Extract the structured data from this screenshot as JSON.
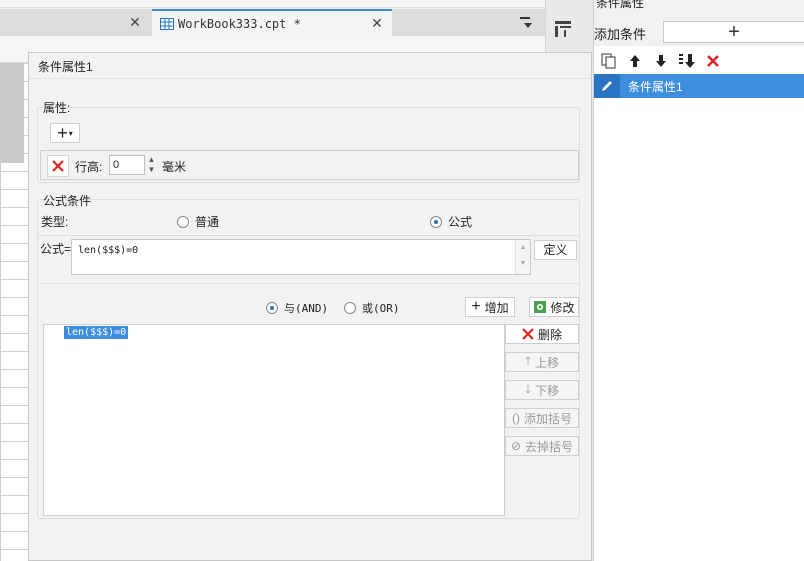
{
  "editor": {
    "tabs": [
      {
        "title": ""
      },
      {
        "title": "WorkBook333.cpt *"
      }
    ]
  },
  "right_panel": {
    "title": "条件属性",
    "add_condition_label": "添加条件",
    "add_condition_button": "+",
    "tools": [
      "copy-icon",
      "arrow-up-icon",
      "arrow-down-icon",
      "sort-down-icon",
      "delete-icon"
    ],
    "conditions": [
      {
        "label": "条件属性1",
        "selected": true
      }
    ]
  },
  "dialog": {
    "title": "条件属性1",
    "attributes": {
      "legend": "属性:",
      "add_button": "+",
      "row_height": {
        "label": "行高:",
        "value": "0",
        "unit": "毫米"
      }
    },
    "formula_condition": {
      "legend": "公式条件",
      "type_label": "类型:",
      "type_options": [
        {
          "label": "普通",
          "selected": false
        },
        {
          "label": "公式",
          "selected": true
        }
      ],
      "formula_label": "公式=",
      "formula_value": "len($$$)=0",
      "define_button": "定义",
      "logic_options": [
        {
          "label": "与(AND)",
          "selected": true
        },
        {
          "label": "或(OR)",
          "selected": false
        }
      ],
      "add_button": "增加",
      "modify_button": "修改",
      "list_items": [
        "len($$$)=0"
      ],
      "side_buttons": {
        "delete": "删除",
        "move_up": "上移",
        "move_down": "下移",
        "add_parens": "添加括号",
        "remove_parens": "去掉括号"
      }
    }
  },
  "colors": {
    "accent": "#3e8ee0",
    "delete_red": "#e02020"
  }
}
